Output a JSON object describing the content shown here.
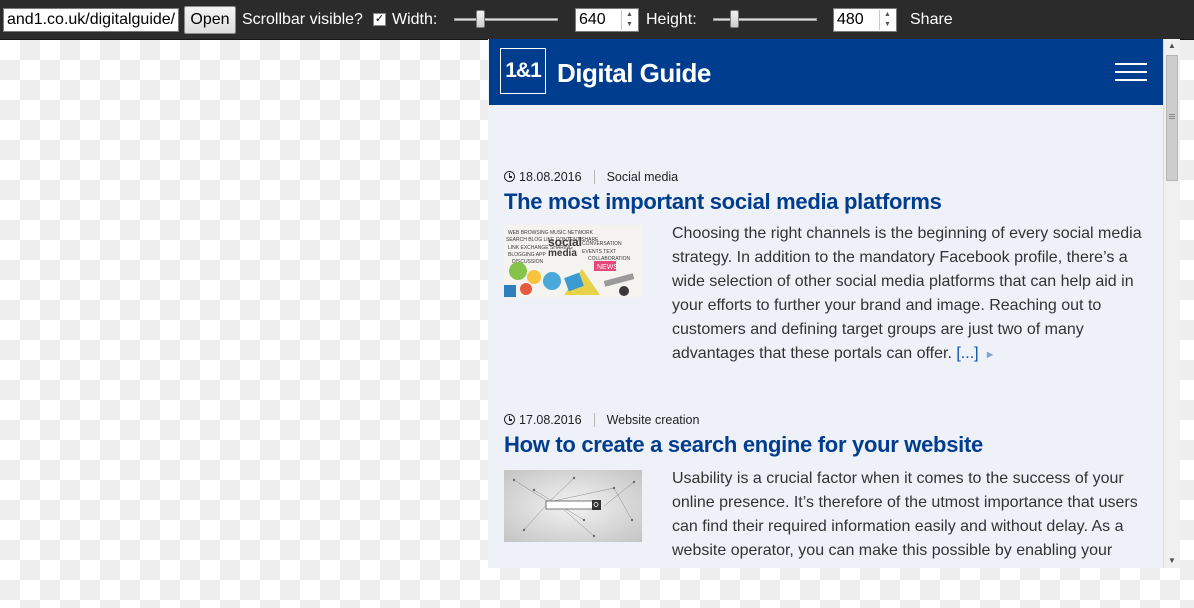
{
  "toolbar": {
    "url_value": "and1.co.uk/digitalguide/",
    "open_label": "Open",
    "scrollbar_label": "Scrollbar visible?",
    "scrollbar_checked": true,
    "checkbox_mark": "✓",
    "width_label": "Width:",
    "width_value": "640",
    "height_label": "Height:",
    "height_value": "480",
    "share_label": "Share"
  },
  "site": {
    "logo_text": "1&1",
    "brand": "Digital Guide",
    "brand_color": "#003d8f",
    "background_color": "#eef1f7"
  },
  "articles": [
    {
      "date": "18.08.2016",
      "category": "Social media",
      "title": "The most important social media platforms",
      "excerpt": "Choosing the right channels is the beginning of every social media strategy. In addition to the mandatory Facebook profile, there’s a wide selection of other social media platforms that can help aid in your efforts to further your brand and image. Reaching out to customers and defining target groups are just two of many advantages that these portals can offer.",
      "more": "[...]",
      "more_arrow": "►",
      "thumbnail": "social-media-word-cloud-illustration"
    },
    {
      "date": "17.08.2016",
      "category": "Website creation",
      "title": "How to create a search engine for your website",
      "excerpt": "Usability is a crucial factor when it comes to the success of your online presence. It’s therefore of the utmost importance that users can find their required information easily and without delay. As a website operator, you can make this possible by enabling your",
      "thumbnail": "search-box-network-illustration"
    }
  ],
  "icons": {
    "clock": "clock-icon",
    "menu": "hamburger-menu-icon",
    "spin_up": "▲",
    "spin_down": "▼",
    "scroll_up": "▲",
    "scroll_down": "▼"
  },
  "controls": {
    "width_slider_fraction": 0.25,
    "height_slider_fraction": 0.2
  }
}
